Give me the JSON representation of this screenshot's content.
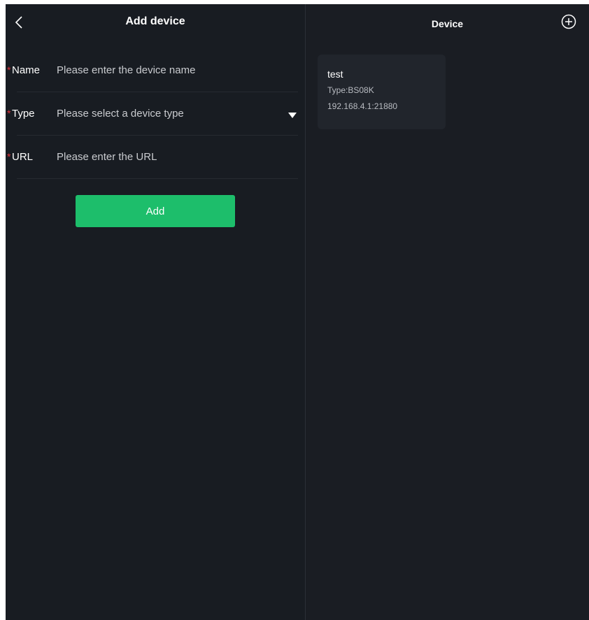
{
  "add_device_screen": {
    "title": "Add device",
    "back_icon": "chevron-left-icon",
    "fields": {
      "name": {
        "required_mark": "*",
        "label": "Name",
        "placeholder": "Please enter the device name",
        "value": ""
      },
      "type": {
        "required_mark": "*",
        "label": "Type",
        "placeholder": "Please select a device type",
        "dropdown_icon": "triangle-down-icon"
      },
      "url": {
        "required_mark": "*",
        "label": "URL",
        "placeholder": "Please enter the URL",
        "value": ""
      }
    },
    "add_button_label": "Add"
  },
  "device_screen": {
    "title": "Device",
    "add_icon": "plus-circle-icon",
    "devices": [
      {
        "name": "test",
        "type": "Type:BS08K",
        "address": "192.168.4.1:21880"
      }
    ]
  },
  "colors": {
    "background": "#181c22",
    "card": "#21252c",
    "accent_green": "#1dbe6b",
    "required_red": "#e0323a"
  }
}
